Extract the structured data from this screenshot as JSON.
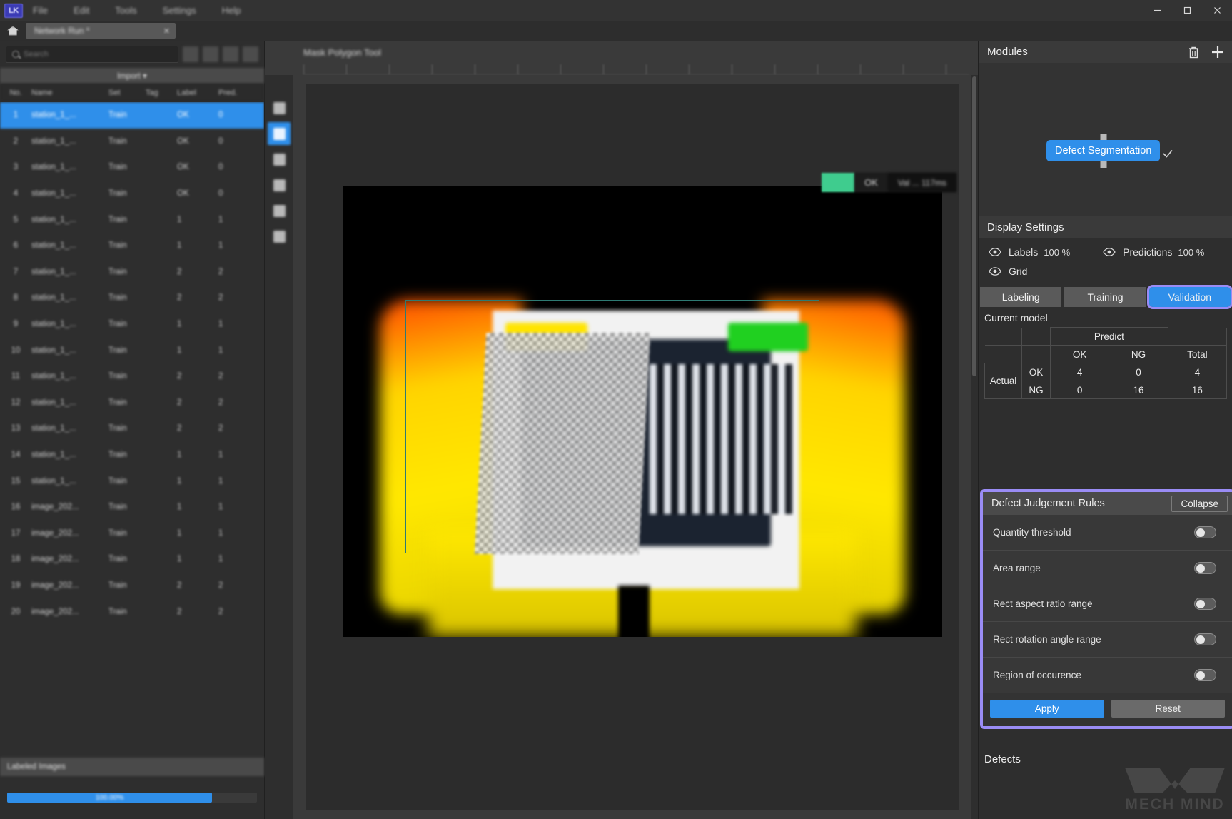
{
  "window": {
    "logo_text": "LK",
    "minimize_label": "–",
    "maximize_label": "□",
    "close_label": "✕"
  },
  "menu": {
    "items": [
      "File",
      "Edit",
      "Tools",
      "Settings",
      "Help"
    ]
  },
  "tabbar": {
    "home_icon": "home-icon",
    "document_tab": "Network Run *",
    "close_tab": "✕"
  },
  "left_panel": {
    "search": {
      "placeholder": "Search",
      "icon": "search-icon"
    },
    "toolbar_icons": [
      "import-images-icon",
      "filter-icon",
      "grid-view-icon",
      "export-icon"
    ],
    "import_button": "Import ▾",
    "columns": [
      "No.",
      "Name",
      "Set",
      "Tag",
      "Label",
      "Pred."
    ],
    "rows": [
      {
        "no": "1",
        "name": "station_1_...",
        "set": "Train",
        "tag": "",
        "label": "OK",
        "pred": "0"
      },
      {
        "no": "2",
        "name": "station_1_...",
        "set": "Train",
        "tag": "",
        "label": "OK",
        "pred": "0"
      },
      {
        "no": "3",
        "name": "station_1_...",
        "set": "Train",
        "tag": "",
        "label": "OK",
        "pred": "0"
      },
      {
        "no": "4",
        "name": "station_1_...",
        "set": "Train",
        "tag": "",
        "label": "OK",
        "pred": "0"
      },
      {
        "no": "5",
        "name": "station_1_...",
        "set": "Train",
        "tag": "",
        "label": "1",
        "pred": "1"
      },
      {
        "no": "6",
        "name": "station_1_...",
        "set": "Train",
        "tag": "",
        "label": "1",
        "pred": "1"
      },
      {
        "no": "7",
        "name": "station_1_...",
        "set": "Train",
        "tag": "",
        "label": "2",
        "pred": "2"
      },
      {
        "no": "8",
        "name": "station_1_...",
        "set": "Train",
        "tag": "",
        "label": "2",
        "pred": "2"
      },
      {
        "no": "9",
        "name": "station_1_...",
        "set": "Train",
        "tag": "",
        "label": "1",
        "pred": "1"
      },
      {
        "no": "10",
        "name": "station_1_...",
        "set": "Train",
        "tag": "",
        "label": "1",
        "pred": "1"
      },
      {
        "no": "11",
        "name": "station_1_...",
        "set": "Train",
        "tag": "",
        "label": "2",
        "pred": "2"
      },
      {
        "no": "12",
        "name": "station_1_...",
        "set": "Train",
        "tag": "",
        "label": "2",
        "pred": "2"
      },
      {
        "no": "13",
        "name": "station_1_...",
        "set": "Train",
        "tag": "",
        "label": "2",
        "pred": "2"
      },
      {
        "no": "14",
        "name": "station_1_...",
        "set": "Train",
        "tag": "",
        "label": "1",
        "pred": "1"
      },
      {
        "no": "15",
        "name": "station_1_...",
        "set": "Train",
        "tag": "",
        "label": "1",
        "pred": "1"
      },
      {
        "no": "16",
        "name": "image_202...",
        "set": "Train",
        "tag": "",
        "label": "1",
        "pred": "1"
      },
      {
        "no": "17",
        "name": "image_202...",
        "set": "Train",
        "tag": "",
        "label": "1",
        "pred": "1"
      },
      {
        "no": "18",
        "name": "image_202...",
        "set": "Train",
        "tag": "",
        "label": "1",
        "pred": "1"
      },
      {
        "no": "19",
        "name": "image_202...",
        "set": "Train",
        "tag": "",
        "label": "2",
        "pred": "2"
      },
      {
        "no": "20",
        "name": "image_202...",
        "set": "Train",
        "tag": "",
        "label": "2",
        "pred": "2"
      }
    ],
    "labeled_images_label": "Labeled Images",
    "progress_text": "100.00%",
    "progress_percent": 82
  },
  "canvas": {
    "tool_title": "Mask Polygon Tool",
    "tools": [
      "pan-icon",
      "polygon-icon",
      "brush-icon",
      "eraser-icon",
      "rect-icon",
      "move-icon"
    ],
    "active_tool_index": 1,
    "badge": {
      "swatch_color": "#3fcc8e",
      "result": "OK",
      "time": "Val ... 117ms"
    }
  },
  "modules": {
    "title": "Modules",
    "delete_icon": "trash-icon",
    "add_icon": "plus-icon",
    "node_label": "Defect Segmentation",
    "check_icon": "check-icon"
  },
  "display_settings": {
    "title": "Display Settings",
    "labels_label": "Labels",
    "labels_value": "100 %",
    "predictions_label": "Predictions",
    "predictions_value": "100 %",
    "grid_label": "Grid",
    "eye_icon": "eye-icon"
  },
  "tabs": {
    "items": [
      {
        "label": "Labeling",
        "active": false
      },
      {
        "label": "Training",
        "active": false
      },
      {
        "label": "Validation",
        "active": true
      }
    ]
  },
  "validation": {
    "current_model_label": "Current model",
    "predict_header": "Predict",
    "actual_header": "Actual",
    "col_ok": "OK",
    "col_ng": "NG",
    "col_total": "Total",
    "row_ok": "OK",
    "row_ng": "NG",
    "matrix": {
      "ok_ok": "4",
      "ok_ng": "0",
      "ok_total": "4",
      "ng_ok": "0",
      "ng_ng": "16",
      "ng_total": "16"
    }
  },
  "defect_rules": {
    "title": "Defect Judgement Rules",
    "collapse_label": "Collapse",
    "rules": [
      {
        "name": "Quantity threshold",
        "enabled": false
      },
      {
        "name": "Area range",
        "enabled": false
      },
      {
        "name": "Rect aspect ratio range",
        "enabled": false
      },
      {
        "name": "Rect rotation angle range",
        "enabled": false
      },
      {
        "name": "Region of occurence",
        "enabled": false
      }
    ],
    "apply_label": "Apply",
    "reset_label": "Reset",
    "highlight_color": "#9a8cf5"
  },
  "defects": {
    "title": "Defects"
  },
  "watermark": {
    "text": "MECH MIND",
    "logo_icon": "mech-mind-logo-icon"
  },
  "colors": {
    "accent": "#2f8fea",
    "panel": "#2e2e2e",
    "header": "#3a3a3a",
    "highlight": "#9a8cf5",
    "ok_green": "#3fcc8e"
  }
}
